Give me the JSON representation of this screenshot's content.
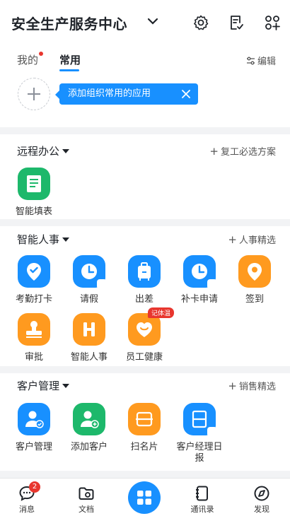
{
  "header": {
    "title": "安全生产服务中心"
  },
  "tabs": {
    "mine": "我的",
    "common": "常用",
    "edit": "编辑"
  },
  "tip": {
    "text": "添加组织常用的应用"
  },
  "sections": {
    "remote": {
      "title": "远程办公",
      "link": "复工必选方案"
    },
    "hr": {
      "title": "智能人事",
      "link": "人事精选"
    },
    "crm": {
      "title": "客户管理",
      "link": "销售精选"
    }
  },
  "apps": {
    "fill": "智能填表",
    "attendance": "考勤打卡",
    "leave": "请假",
    "trip": "出差",
    "makeup": "补卡申请",
    "signin": "签到",
    "approval": "审批",
    "smarthr": "智能人事",
    "health": "员工健康",
    "health_badge": "记体温",
    "customer_mgmt": "客户管理",
    "add_customer": "添加客户",
    "scan_card": "扫名片",
    "manager_log": "客户经理日报"
  },
  "nav": {
    "messages": "消息",
    "messages_badge": "2",
    "docs": "文档",
    "contacts": "通讯录",
    "discover": "发现"
  },
  "colors": {
    "primary": "#1890ff",
    "orange": "#ff9a1f",
    "green": "#1db86b",
    "red": "#e8362e"
  }
}
